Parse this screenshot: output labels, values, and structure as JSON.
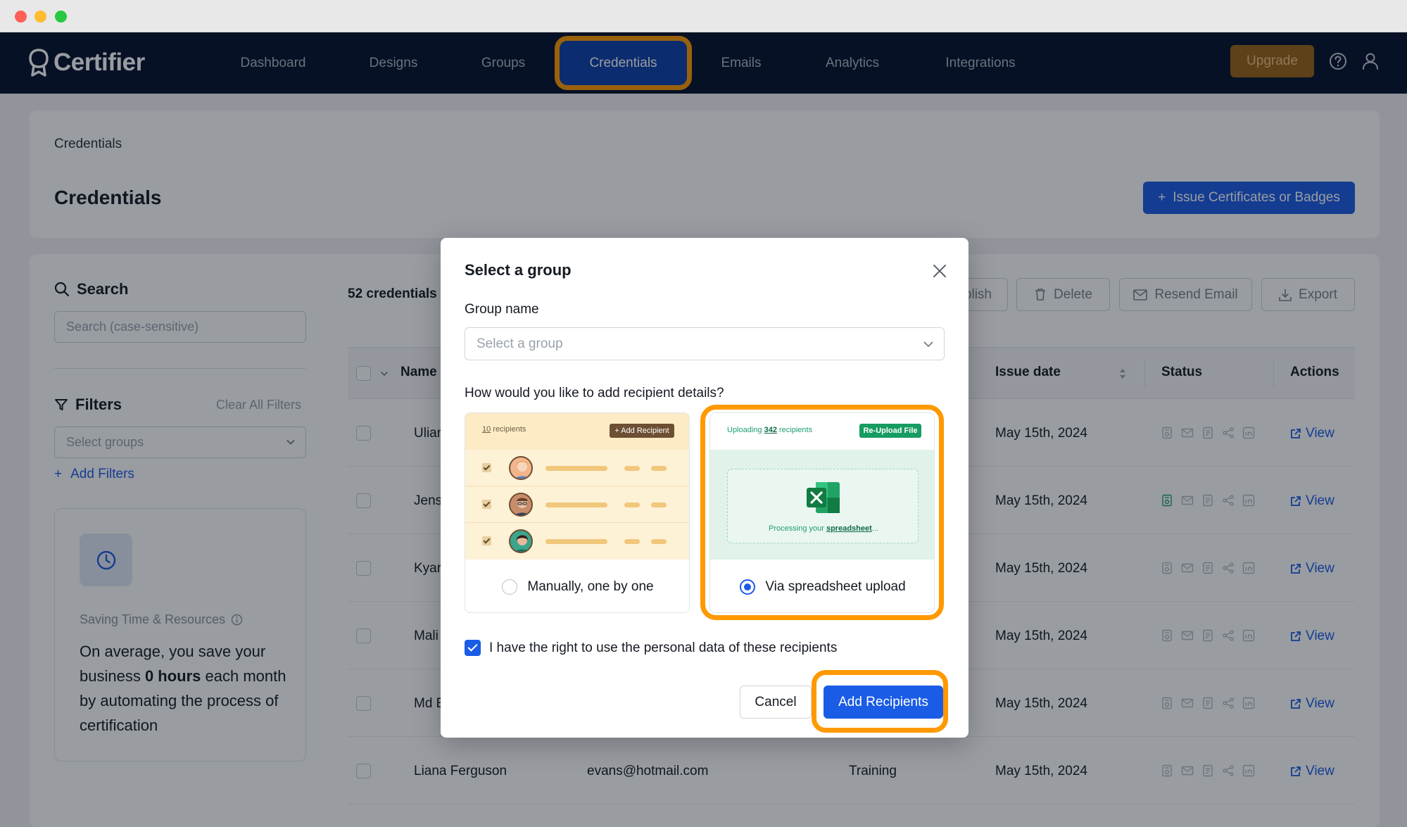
{
  "app": {
    "brand": "Certifier"
  },
  "nav": {
    "items": [
      {
        "label": "Dashboard"
      },
      {
        "label": "Designs"
      },
      {
        "label": "Groups"
      },
      {
        "label": "Credentials"
      },
      {
        "label": "Emails"
      },
      {
        "label": "Analytics"
      },
      {
        "label": "Integrations"
      }
    ],
    "active": "Credentials",
    "upgrade_label": "Upgrade"
  },
  "header": {
    "breadcrumb": "Credentials",
    "title": "Credentials",
    "issue_label": "Issue Certificates or Badges",
    "issue_plus": "+"
  },
  "sidebar": {
    "search_label": "Search",
    "search_placeholder": "Search (case-sensitive)",
    "filters_label": "Filters",
    "clear_filters": "Clear All Filters",
    "groups_placeholder": "Select groups",
    "add_filters_plus": "+",
    "add_filters": "Add Filters",
    "saving": {
      "title": "Saving Time & Resources",
      "text_1": "On average, you save your business ",
      "text_bold": "0 hours",
      "text_2": " each month by automating the process of certification"
    }
  },
  "table": {
    "count": "52 credentials",
    "toolbar": {
      "publish": "blish",
      "delete": "Delete",
      "resend": "Resend Email",
      "export": "Export"
    },
    "columns": {
      "name": "Name",
      "issue_date": "Issue date",
      "status": "Status",
      "actions": "Actions"
    },
    "rows": [
      {
        "name": "Ulian",
        "email": "",
        "group": "",
        "issue_date": "May 15th, 2024",
        "action": "View"
      },
      {
        "name": "Jense",
        "email": "",
        "group": "",
        "issue_date": "May 15th, 2024",
        "action": "View"
      },
      {
        "name": "Kyar",
        "email": "",
        "group": "",
        "issue_date": "May 15th, 2024",
        "action": "View"
      },
      {
        "name": "Mali",
        "email": "",
        "group": "",
        "issue_date": "May 15th, 2024",
        "action": "View"
      },
      {
        "name": "Md E",
        "email": "",
        "group": "",
        "issue_date": "May 15th, 2024",
        "action": "View"
      },
      {
        "name": "Liana Ferguson",
        "email": "evans@hotmail.com",
        "group": "Training",
        "issue_date": "May 15th, 2024",
        "action": "View"
      }
    ]
  },
  "modal": {
    "title": "Select a group",
    "group_label": "Group name",
    "group_placeholder": "Select a group",
    "question": "How would you like to add recipient details?",
    "manual": {
      "label": "Manually, one by one",
      "count_num": "10",
      "count_text": " recipients",
      "add_btn": "+ Add Recipient",
      "selected": false
    },
    "spreadsheet": {
      "label": "Via spreadsheet upload",
      "uploading_pre": "Uploading ",
      "uploading_num": "342",
      "uploading_post": " recipients",
      "reupload": "Re-Upload File",
      "processing_pre": "Processing your ",
      "processing_link": "spreadsheet",
      "processing_post": "...",
      "selected": true
    },
    "consent": "I have the right to use the personal data of these recipients",
    "consent_checked": true,
    "cancel": "Cancel",
    "add": "Add Recipients"
  },
  "colors": {
    "primary": "#1a5ce6",
    "nav_bg": "#05112a",
    "highlight": "#ff9900",
    "upgrade": "#9a6315",
    "excel_green": "#169c62"
  }
}
